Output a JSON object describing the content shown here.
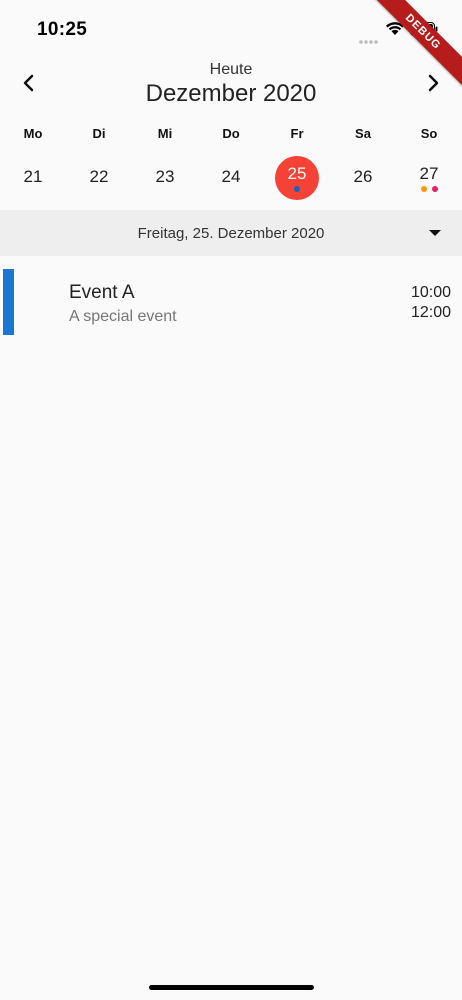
{
  "status_bar": {
    "time": "10:25",
    "icons": [
      "signal-icon",
      "wifi-icon",
      "battery-icon"
    ]
  },
  "debug_banner": "DEBUG",
  "header": {
    "today_label": "Heute",
    "month_label": "Dezember 2020",
    "prev_icon": "chevron-left-icon",
    "next_icon": "chevron-right-icon"
  },
  "weekdays": [
    "Mo",
    "Di",
    "Mi",
    "Do",
    "Fr",
    "Sa",
    "So"
  ],
  "days": [
    {
      "num": "21",
      "selected": false,
      "dots": []
    },
    {
      "num": "22",
      "selected": false,
      "dots": []
    },
    {
      "num": "23",
      "selected": false,
      "dots": []
    },
    {
      "num": "24",
      "selected": false,
      "dots": []
    },
    {
      "num": "25",
      "selected": true,
      "dots": [
        "#1565c0"
      ]
    },
    {
      "num": "26",
      "selected": false,
      "dots": []
    },
    {
      "num": "27",
      "selected": false,
      "dots": [
        "#ff9800",
        "#e91e63"
      ]
    }
  ],
  "date_bar": {
    "label": "Freitag, 25. Dezember 2020",
    "icon": "dropdown-arrow-icon"
  },
  "events": [
    {
      "title": "Event A",
      "subtitle": "A special event",
      "start": "10:00",
      "end": "12:00",
      "color": "#1976d2"
    }
  ],
  "colors": {
    "selected_day": "#f44336",
    "background": "#fafafa",
    "date_bar": "#eeeeee",
    "debug_banner": "#b71c1c"
  }
}
